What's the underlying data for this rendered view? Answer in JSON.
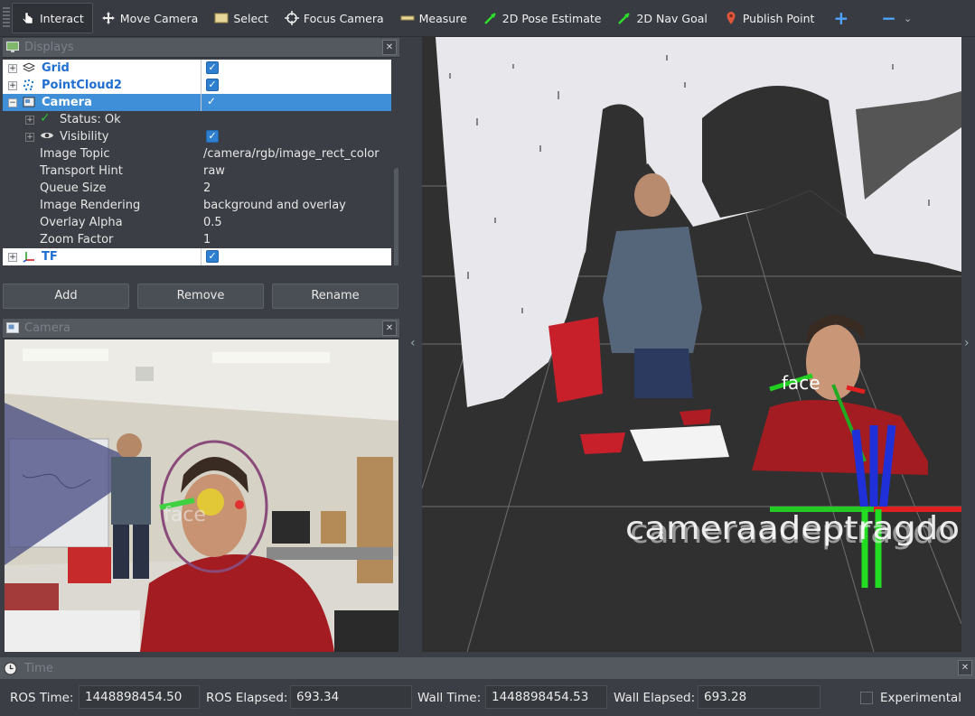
{
  "toolbar": {
    "tools": [
      {
        "label": "Interact",
        "icon": "interact-cursor-icon"
      },
      {
        "label": "Move Camera",
        "icon": "move-camera-icon"
      },
      {
        "label": "Select",
        "icon": "select-icon"
      },
      {
        "label": "Focus Camera",
        "icon": "focus-camera-icon"
      },
      {
        "label": "Measure",
        "icon": "measure-icon"
      },
      {
        "label": "2D Pose Estimate",
        "icon": "pose-estimate-arrow-icon"
      },
      {
        "label": "2D Nav Goal",
        "icon": "nav-goal-arrow-icon"
      },
      {
        "label": "Publish Point",
        "icon": "publish-point-pin-icon"
      }
    ],
    "plus": "+",
    "minus": "−",
    "chevron": "⌄"
  },
  "displays": {
    "title": "Displays",
    "close": "✕",
    "items": [
      {
        "name": "Grid",
        "checked": true
      },
      {
        "name": "PointCloud2",
        "checked": true
      },
      {
        "name": "Camera",
        "checked": true
      },
      {
        "name": "TF",
        "checked": true
      }
    ],
    "camera_props": [
      {
        "name": "Status: Ok",
        "value": ""
      },
      {
        "name": "Visibility",
        "value": ""
      },
      {
        "name": "Image Topic",
        "value": "/camera/rgb/image_rect_color"
      },
      {
        "name": "Transport Hint",
        "value": "raw"
      },
      {
        "name": "Queue Size",
        "value": "2"
      },
      {
        "name": "Image Rendering",
        "value": "background and overlay"
      },
      {
        "name": "Overlay Alpha",
        "value": "0.5"
      },
      {
        "name": "Zoom Factor",
        "value": "1"
      }
    ],
    "buttons": {
      "add": "Add",
      "remove": "Remove",
      "rename": "Rename"
    }
  },
  "camera_panel": {
    "title": "Camera",
    "close": "✕",
    "overlay_text": "face"
  },
  "view3d": {
    "frame_label_face": "face",
    "frame_labels_stack": "cameraadeptragdo",
    "left_arrow": "‹",
    "right_arrow": "›"
  },
  "time": {
    "title": "Time",
    "close": "✕",
    "ros_time_label": "ROS Time:",
    "ros_time": "1448898454.50",
    "ros_elapsed_label": "ROS Elapsed:",
    "ros_elapsed": "693.34",
    "wall_time_label": "Wall Time:",
    "wall_time": "1448898454.53",
    "wall_elapsed_label": "Wall Elapsed:",
    "wall_elapsed": "693.28",
    "experimental_label": "Experimental",
    "experimental_checked": false
  },
  "colors": {
    "accent": "#3f8fd8",
    "link_blue": "#1f6fd1",
    "panel_bg": "#3b3f45",
    "title_bg": "#54585f"
  }
}
